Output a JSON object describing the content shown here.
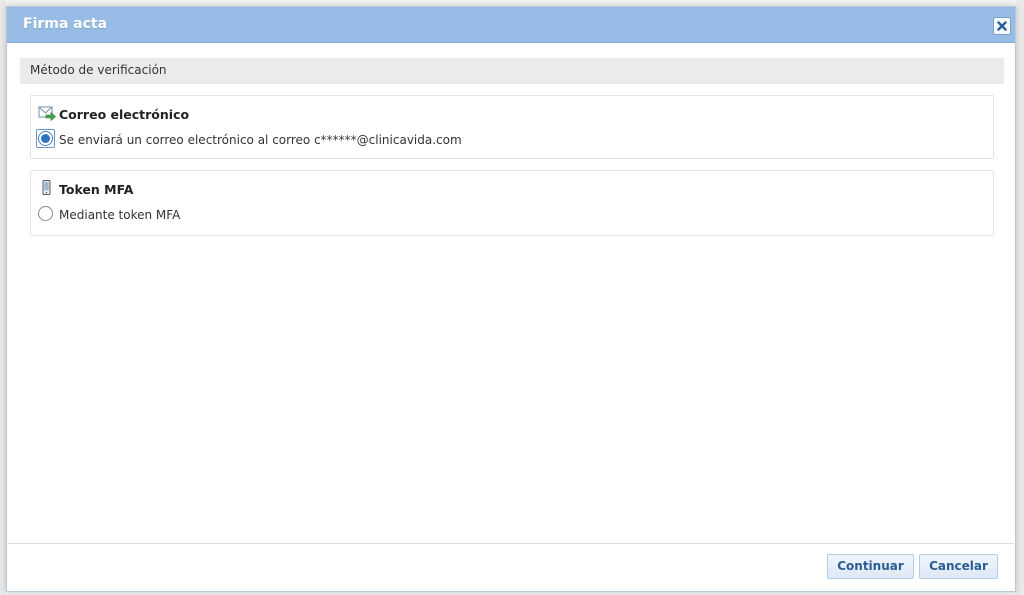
{
  "dialog": {
    "title": "Firma acta",
    "close_icon": "close-icon"
  },
  "section": {
    "title": "Método de verificación"
  },
  "options": {
    "email": {
      "icon": "email-arrow-icon",
      "title": "Correo electrónico",
      "label": "Se enviará un correo electrónico al correo c******@clinicavida.com",
      "selected": true
    },
    "token": {
      "icon": "mobile-phone-icon",
      "title": "Token MFA",
      "label": "Mediante token MFA",
      "selected": false
    }
  },
  "buttons": {
    "continue_label": "Continuar",
    "cancel_label": "Cancelar"
  },
  "colors": {
    "titlebar": "#97bde6",
    "button_text": "#2a5d94",
    "radio_selected": "#2f73c4"
  }
}
